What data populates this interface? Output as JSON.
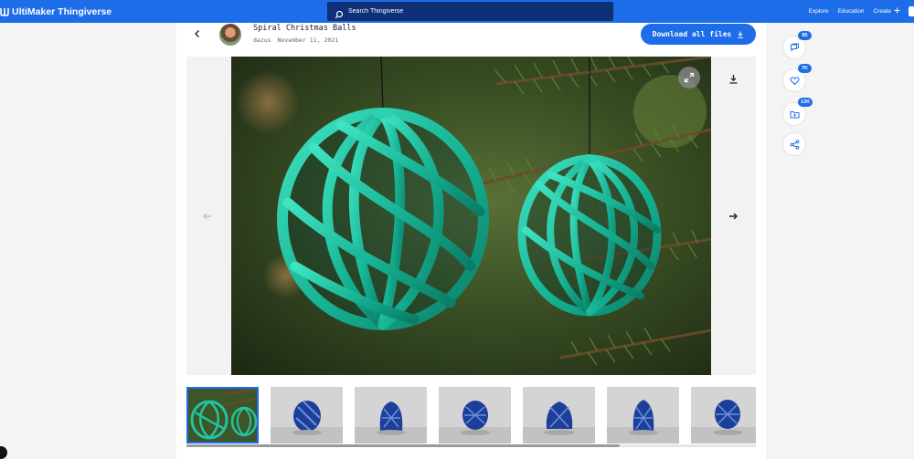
{
  "brand": {
    "name": "UltiMaker Thingiverse",
    "accent": "#1d6ce8"
  },
  "search": {
    "placeholder": "Search Thingiverse"
  },
  "nav": {
    "explore": "Explore",
    "education": "Education",
    "create": "Create"
  },
  "thing": {
    "title": "Spiral Christmas Balls",
    "author": "dazus",
    "date": "November 11, 2021",
    "download_all_label": "Download all files"
  },
  "icons": {
    "back": "arrow-left-icon",
    "download": "download-icon",
    "expand": "expand-icon",
    "prev": "arrow-left-icon",
    "next": "arrow-right-icon",
    "comments": "comments-icon",
    "like": "heart-icon",
    "collect": "folder-icon",
    "share": "share-icon"
  },
  "actions": {
    "comments_count": "85",
    "likes_count": "7K",
    "collections_count": "13K"
  },
  "gallery": {
    "thumbnail_count": 7,
    "active_index": 0
  }
}
